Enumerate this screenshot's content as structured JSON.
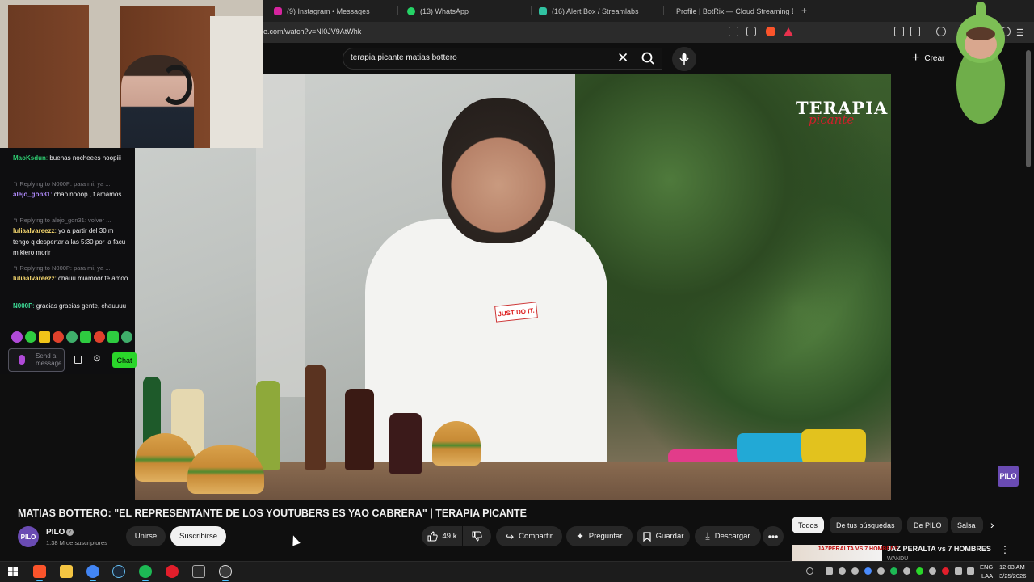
{
  "browser": {
    "tabs": [
      {
        "label": "(9) Instagram • Messages",
        "icon_color": "#d6249f"
      },
      {
        "label": "(13) WhatsApp",
        "icon_color": "#25d366"
      },
      {
        "label": "(16) Alert Box / Streamlabs",
        "icon_color": "#31c3a2"
      },
      {
        "label": "Profile | BotRix — Cloud Streaming B",
        "icon_color": "#ffffff"
      }
    ],
    "new_tab": "+",
    "url": "e.com/watch?v=NI0JV9AtWhk"
  },
  "masthead": {
    "search_query": "terapia picante matias bottero",
    "clear_icon": "✕",
    "create_label": "Crear"
  },
  "video": {
    "watermark_line1": "TERAPIA",
    "watermark_line2": "picante",
    "shirt_logo": "JUST DO IT.",
    "channel_watermark": "PILO"
  },
  "chat": {
    "messages": [
      {
        "user": "MaoKsdun",
        "color": "#2ecc71",
        "text": " buenas nocheees noopiii"
      },
      {
        "reply": "Replying to N000P: para mi, ya ..."
      },
      {
        "user": "alejo_gon31",
        "color": "#b28cff",
        "text": " chao nooop , t amamos"
      },
      {
        "reply": "Replying to alejo_gon31: volver ..."
      },
      {
        "user": "luliaalvareezz",
        "color": "#f5d76e",
        "text": " yo a partir del 30 m tengo q despertar a las 5:30 por la facu m kiero morir"
      },
      {
        "reply": "Replying to N000P: para mi, ya ..."
      },
      {
        "user": "luliaalvareezz",
        "color": "#f5d76e",
        "text": " chauu miamoor te amoo"
      },
      {
        "user": "N000P",
        "color": "#3ddc97",
        "text": " gracias gracias gente, chauuuu"
      }
    ],
    "input_placeholder": "Send a message",
    "chat_button": "Chat"
  },
  "video_info": {
    "title": "MATIAS BOTTERO: \"EL REPRESENTANTE DE LOS YOUTUBERS ES YAO CABRERA\" | TERAPIA PICANTE",
    "channel_name": "PILO",
    "channel_avatar_text": "PILO",
    "subscribers": "1.38 M de suscriptores",
    "join_label": "Unirse",
    "subscribe_label": "Suscribirse",
    "likes": "49 k",
    "share_label": "Compartir",
    "ask_label": "Preguntar",
    "save_label": "Guardar",
    "download_label": "Descargar"
  },
  "chips": [
    "Todos",
    "De tus búsquedas",
    "De PILO",
    "Salsa"
  ],
  "recommendation": {
    "thumb_text": "JAZPERALTA VS 7 HOMBRES",
    "title": "JAZ PERALTA vs 7 HOMBRES",
    "channel": "WANDU"
  },
  "taskbar": {
    "apps": [
      {
        "name": "brave",
        "color": "#fb542b"
      },
      {
        "name": "file-explorer",
        "color": "#f4c542"
      },
      {
        "name": "chrome",
        "color": "#4285f4"
      },
      {
        "name": "steam",
        "color": "#1b2838"
      },
      {
        "name": "spotify",
        "color": "#1db954"
      },
      {
        "name": "app-red",
        "color": "#e21e2b"
      },
      {
        "name": "epic-games",
        "color": "#2a2a2a"
      },
      {
        "name": "obs",
        "color": "#3a3a3a"
      }
    ],
    "lang1": "ENG",
    "lang2": "LAA",
    "time": "12:03 AM",
    "date": "3/25/2026"
  }
}
